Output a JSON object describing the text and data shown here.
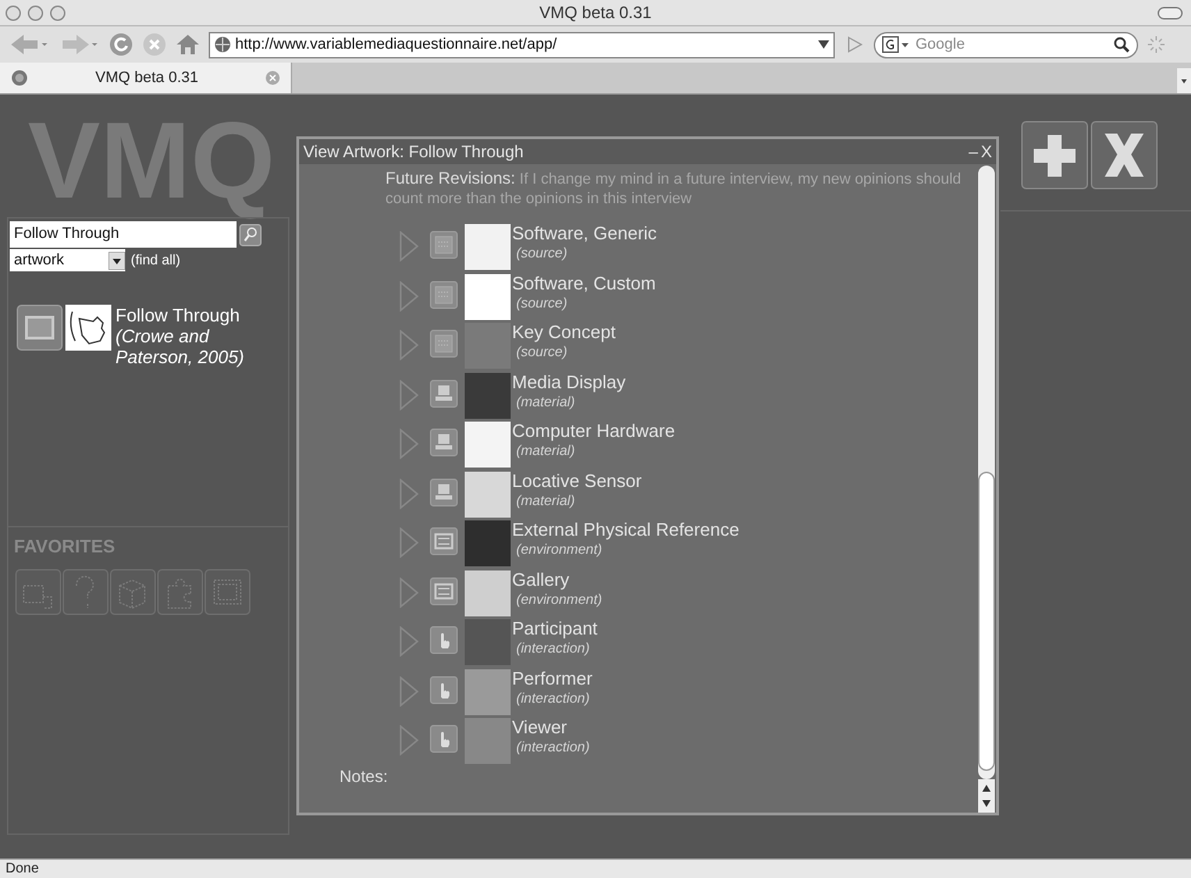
{
  "window": {
    "title": "VMQ beta 0.31"
  },
  "toolbar": {
    "url": "http://www.variablemediaquestionnaire.net/app/",
    "search_placeholder": "Google"
  },
  "tabs": [
    {
      "label": "VMQ beta 0.31",
      "selected": true
    }
  ],
  "app": {
    "logo": "VMQ",
    "search": {
      "value": "Follow Through",
      "type_select": "artwork",
      "find_all": "(find all)"
    },
    "results": [
      {
        "title": "Follow Through",
        "credit": "(Crowe and Paterson, 2005)"
      }
    ],
    "favorites": {
      "heading": "FAVORITES"
    }
  },
  "dialog": {
    "title": "View Artwork: Follow Through",
    "minimize": "–",
    "close": "X",
    "future_revisions": {
      "label": "Future Revisions:",
      "text": "If I change my mind in a future interview, my new opinions should count more than the opinions in this interview"
    },
    "items": [
      {
        "name": "Software, Generic",
        "category": "(source)",
        "kind": "source"
      },
      {
        "name": "Software, Custom",
        "category": "(source)",
        "kind": "source"
      },
      {
        "name": "Key Concept",
        "category": "(source)",
        "kind": "source"
      },
      {
        "name": "Media Display",
        "category": "(material)",
        "kind": "material"
      },
      {
        "name": "Computer Hardware",
        "category": "(material)",
        "kind": "material"
      },
      {
        "name": "Locative Sensor",
        "category": "(material)",
        "kind": "material"
      },
      {
        "name": "External Physical Reference",
        "category": "(environment)",
        "kind": "environment"
      },
      {
        "name": "Gallery",
        "category": "(environment)",
        "kind": "environment"
      },
      {
        "name": "Participant",
        "category": "(interaction)",
        "kind": "interaction"
      },
      {
        "name": "Performer",
        "category": "(interaction)",
        "kind": "interaction"
      },
      {
        "name": "Viewer",
        "category": "(interaction)",
        "kind": "interaction"
      }
    ],
    "notes_label": "Notes:"
  },
  "status_bar": "Done"
}
